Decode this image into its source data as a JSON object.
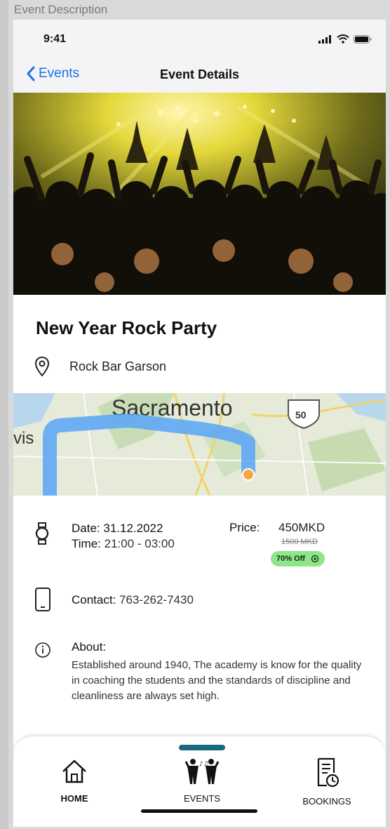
{
  "frame": {
    "title": "Event Description"
  },
  "status": {
    "time": "9:41"
  },
  "nav": {
    "back_label": "Events",
    "title": "Event Details"
  },
  "event": {
    "name": "New Year Rock Party",
    "location": "Rock Bar Garson",
    "date_label": "Date:",
    "date_value": "31.12.2022",
    "time_label": "Time:",
    "time_value": "21:00 - 03:00",
    "price_label": "Price:",
    "price_value": "450MKD",
    "price_old": "1500 MKD",
    "discount": "70% Off",
    "contact_label": "Contact:",
    "contact_value": "763-262-7430",
    "about_title": "About:",
    "about_text": "Established around 1940, The academy is know for the quality in coaching the students and the standards of discipline and cleanliness  are always set high."
  },
  "map": {
    "city_label": "Sacramento",
    "road_label": "50",
    "side_label": "vis"
  },
  "tabs": [
    {
      "label": "HOME",
      "icon": "house-icon"
    },
    {
      "label": "EVENTS",
      "icon": "dancers-icon"
    },
    {
      "label": "BOOKINGS",
      "icon": "calendar-clock-icon"
    }
  ],
  "colors": {
    "accent": "#1a73e8",
    "active_tab": "#1a6a7f",
    "discount_bg": "#8fe58a",
    "route": "#5fa8f5"
  }
}
